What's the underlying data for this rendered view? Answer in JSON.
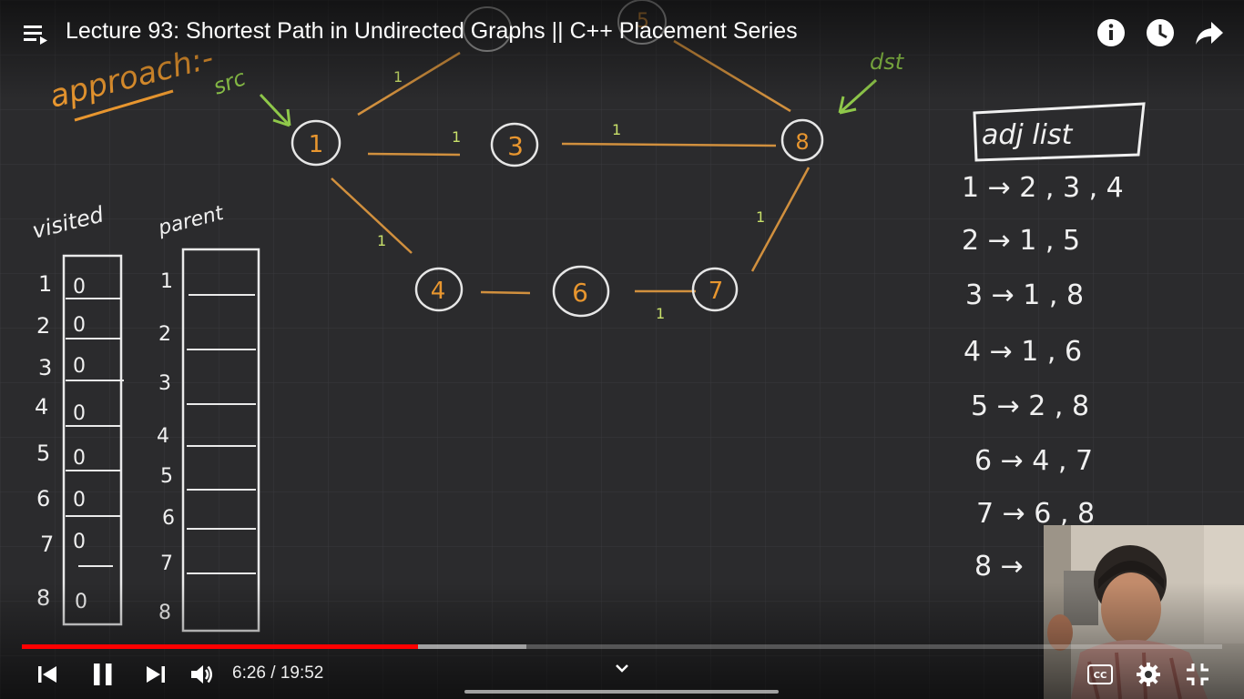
{
  "video": {
    "title": "Lecture 93: Shortest Path in Undirected Graphs || C++ Placement Series",
    "current_time": "6:26",
    "duration": "19:52",
    "time_display": "6:26 / 19:52",
    "progress_fraction": 0.33,
    "buffered_fraction": 0.42,
    "accent_color": "#ff0000"
  },
  "icons": {
    "menu": "playlist-icon",
    "info": "info-icon",
    "watch_later": "clock-icon",
    "share": "share-icon",
    "prev": "previous-icon",
    "pause": "pause-icon",
    "next": "next-icon",
    "volume": "volume-icon",
    "chevron": "chevron-down-icon",
    "captions": "captions-icon",
    "settings": "gear-icon",
    "exit_fullscreen": "exit-fullscreen-icon"
  },
  "board": {
    "approach_label": "approach:-",
    "src_label": "src",
    "dst_label": "dst",
    "nodes": [
      "1",
      "3",
      "8",
      "4",
      "6",
      "7",
      "5"
    ],
    "edge_weight": "1",
    "visited_header": "visited",
    "parent_header": "parent",
    "row_indices": [
      "1",
      "2",
      "3",
      "4",
      "5",
      "6",
      "7",
      "8"
    ],
    "visited_values": [
      "0",
      "0",
      "0",
      "0",
      "0",
      "0",
      "0",
      "0"
    ],
    "adj_header": "adj list",
    "adj_list": [
      "1 → 2 , 3 , 4",
      "2 → 1 , 5",
      "3 → 1 , 8",
      "4 → 1 , 6",
      "5 → 2 , 8",
      "6 → 4 , 7",
      "7 → 6 , 8",
      "8 →"
    ]
  }
}
